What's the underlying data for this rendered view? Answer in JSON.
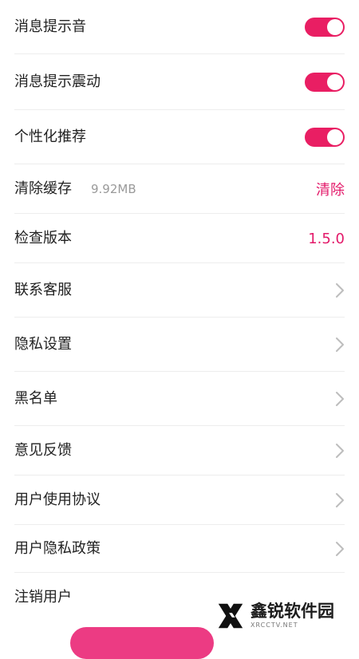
{
  "settings": {
    "items": [
      {
        "label": "消息提示音",
        "type": "toggle",
        "on": true
      },
      {
        "label": "消息提示震动",
        "type": "toggle",
        "on": true
      },
      {
        "label": "个性化推荐",
        "type": "toggle",
        "on": true
      },
      {
        "label": "清除缓存",
        "type": "action",
        "meta": "9.92MB",
        "action_label": "清除"
      },
      {
        "label": "检查版本",
        "type": "value",
        "value": "1.5.0"
      },
      {
        "label": "联系客服",
        "type": "nav",
        "icon": "chevron-right-icon"
      },
      {
        "label": "隐私设置",
        "type": "nav",
        "icon": "chevron-right-icon"
      },
      {
        "label": "黑名单",
        "type": "nav",
        "icon": "chevron-right-icon"
      },
      {
        "label": "意见反馈",
        "type": "nav",
        "icon": "chevron-right-icon"
      },
      {
        "label": "用户使用协议",
        "type": "nav",
        "icon": "chevron-right-icon"
      },
      {
        "label": "用户隐私政策",
        "type": "nav",
        "icon": "chevron-right-icon"
      },
      {
        "label": "注销用户",
        "type": "plain"
      }
    ]
  },
  "watermark": {
    "title": "鑫锐软件园",
    "subtitle": "XRCCTV.NET"
  },
  "colors": {
    "accent": "#e91e63",
    "accent_text": "#e31a6a",
    "divider": "#ededed",
    "muted_text": "#9a9a9a"
  }
}
